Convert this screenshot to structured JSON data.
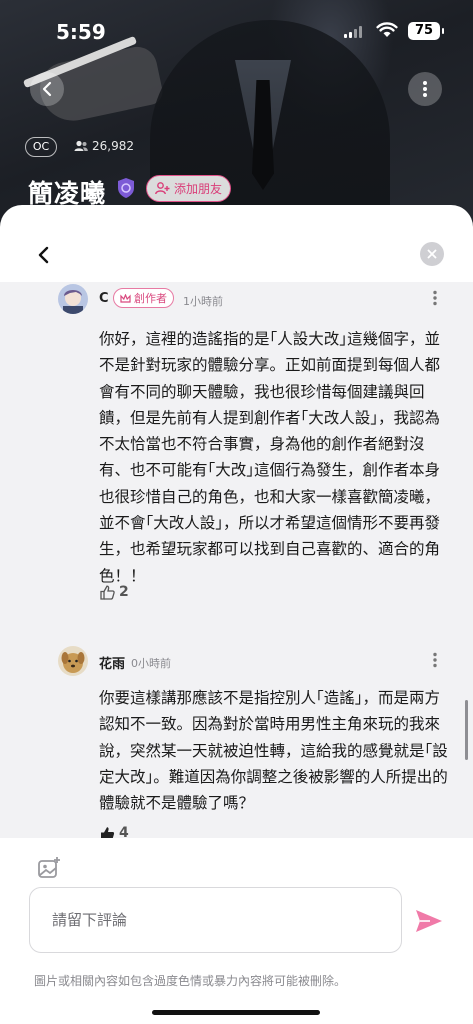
{
  "status_bar": {
    "time": "5:59",
    "battery": "75"
  },
  "character": {
    "tag": "OC",
    "followers": "26,982",
    "name": "簡凌曦",
    "add_friend_label": "添加朋友"
  },
  "comments": [
    {
      "author": "C",
      "badge": "創作者",
      "time": "1小時前",
      "body": "你好，這裡的造謠指的是｢人設大改｣這幾個字，並不是針對玩家的體驗分享。正如前面提到每個人都會有不同的聊天體驗，我也很珍惜每個建議與回饋，但是先前有人提到創作者｢大改人設｣，我認為不太恰當也不符合事實，身為他的創作者絕對沒有、也不可能有｢大改｣這個行為發生，創作者本身也很珍惜自己的角色，也和大家一樣喜歡簡凌曦，並不會｢大改人設｣，所以才希望這個情形不要再發生，也希望玩家都可以找到自己喜歡的、適合的角色！！",
      "likes": "2"
    },
    {
      "author": "花雨",
      "time": "0小時前",
      "body": "你要這樣講那應該不是指控別人｢造謠｣，而是兩方認知不一致。因為對於當時用男性主角來玩的我來說，突然某一天就被迫性轉，這給我的感覺就是｢設定大改｣。難道因為你調整之後被影響的人所提出的體驗就不是體驗了嗎？",
      "likes": "4"
    }
  ],
  "input": {
    "placeholder": "請留下評論",
    "notice": "圖片或相關內容如包含過度色情或暴力內容將可能被刪除。"
  },
  "colors": {
    "accent_pink": "#e2528a",
    "send_pink": "#f07aa8"
  }
}
